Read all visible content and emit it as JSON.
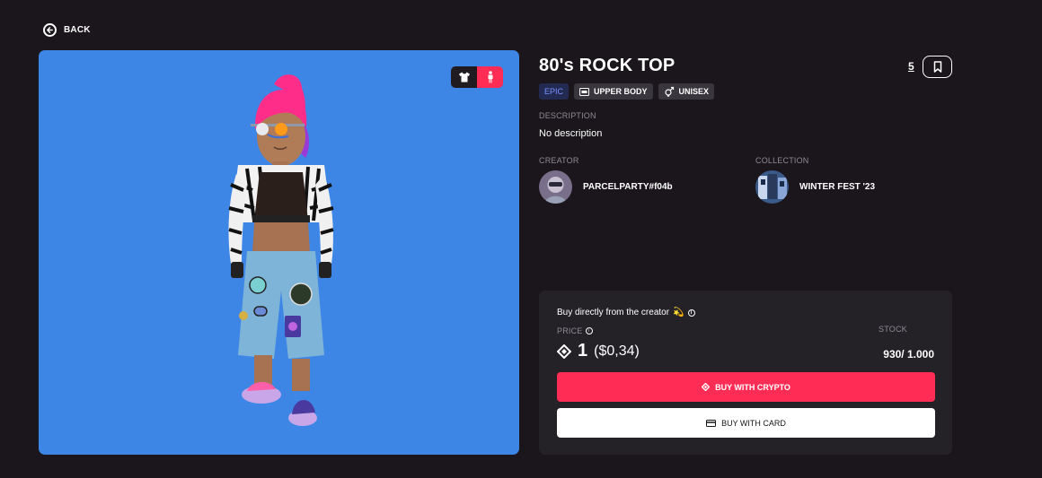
{
  "nav": {
    "back_label": "BACK"
  },
  "item": {
    "title": "80's ROCK TOP",
    "likes": "5",
    "tags": {
      "rarity": "EPIC",
      "category": "UPPER BODY",
      "gender": "UNISEX"
    },
    "description_label": "DESCRIPTION",
    "description": "No description"
  },
  "creator": {
    "label": "CREATOR",
    "name": "PARCELPARTY#f04b"
  },
  "collection": {
    "label": "COLLECTION",
    "name": "WINTER FEST '23"
  },
  "buy": {
    "headline": "Buy directly from the creator",
    "emoji": "💫",
    "price_label": "PRICE",
    "price": "1",
    "price_usd": "($0,34)",
    "stock_label": "STOCK",
    "stock": "930/ 1.000",
    "crypto_label": "BUY WITH CRYPTO",
    "card_label": "BUY WITH CARD"
  },
  "colors": {
    "background": "#1a161b",
    "preview_bg": "#3d86e6",
    "accent": "#ff2d55",
    "panel": "#242127",
    "rarity_text": "#7a92ff"
  },
  "icons": {
    "back": "arrow-left-circle-icon",
    "wearable_toggle": "tshirt-icon",
    "avatar_toggle": "person-icon",
    "bookmark": "bookmark-icon",
    "category": "upper-body-icon",
    "gender": "unisex-icon",
    "mana": "mana-diamond-icon",
    "card": "credit-card-icon",
    "info": "info-icon"
  }
}
